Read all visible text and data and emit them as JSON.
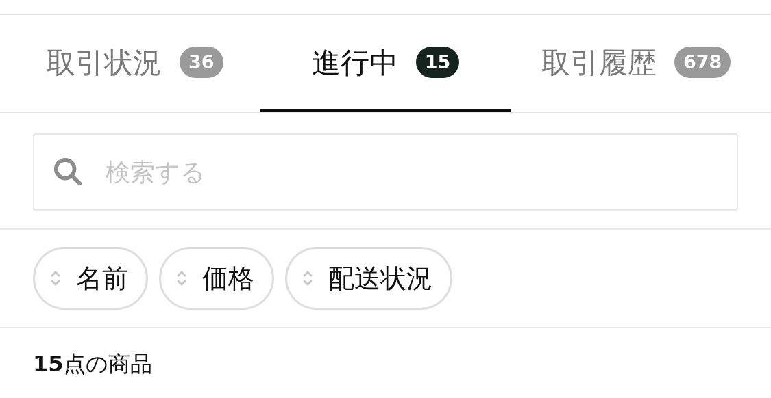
{
  "tabs": [
    {
      "label": "取引状況",
      "count": "36",
      "selected": false
    },
    {
      "label": "進行中",
      "count": "15",
      "selected": true
    },
    {
      "label": "取引履歴",
      "count": "678",
      "selected": false
    }
  ],
  "search": {
    "placeholder": "検索する"
  },
  "sort_chips": [
    {
      "label": "名前"
    },
    {
      "label": "価格"
    },
    {
      "label": "配送状況"
    }
  ],
  "result_count": "**15**点の商品"
}
